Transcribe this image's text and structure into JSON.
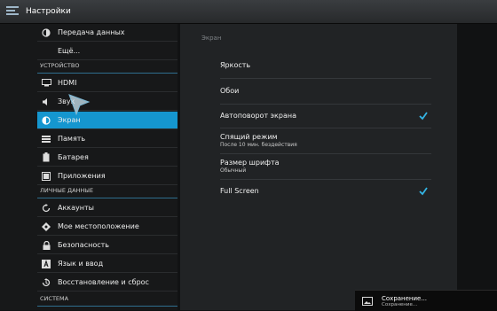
{
  "app": {
    "title": "Настройки"
  },
  "sidebar": {
    "items_top": [
      {
        "label": "Передача данных",
        "icon": "data-usage-icon"
      },
      {
        "label": "Ещё...",
        "icon": ""
      }
    ],
    "section_device": "УСТРОЙСТВО",
    "items_device": [
      {
        "label": "HDMI",
        "icon": "hdmi-icon"
      },
      {
        "label": "Звук",
        "icon": "sound-icon"
      },
      {
        "label": "Экран",
        "icon": "display-icon",
        "selected": true
      },
      {
        "label": "Память",
        "icon": "storage-icon"
      },
      {
        "label": "Батарея",
        "icon": "battery-icon"
      },
      {
        "label": "Приложения",
        "icon": "apps-icon"
      }
    ],
    "section_personal": "ЛИЧНЫЕ ДАННЫЕ",
    "items_personal": [
      {
        "label": "Аккаунты",
        "icon": "sync-icon"
      },
      {
        "label": "Мое местоположение",
        "icon": "location-icon"
      },
      {
        "label": "Безопасность",
        "icon": "lock-icon"
      },
      {
        "label": "Язык и ввод",
        "icon": "language-icon"
      },
      {
        "label": "Восстановление и сброс",
        "icon": "backup-icon"
      }
    ],
    "section_system": "СИСТЕМА"
  },
  "panel": {
    "title": "Экран",
    "rows": [
      {
        "title": "Яркость"
      },
      {
        "title": "Обои"
      },
      {
        "title": "Автоповорот экрана",
        "checked": true
      },
      {
        "title": "Спящий режим",
        "summary": "После 10 мин. бездействия"
      },
      {
        "title": "Размер шрифта",
        "summary": "Обычный"
      },
      {
        "title": "Full Screen",
        "checked": true
      }
    ]
  },
  "toast": {
    "title": "Сохранение...",
    "subtitle": "Сохранение..."
  },
  "colors": {
    "accent": "#1596cf",
    "checkbox": "#33b5e5"
  }
}
